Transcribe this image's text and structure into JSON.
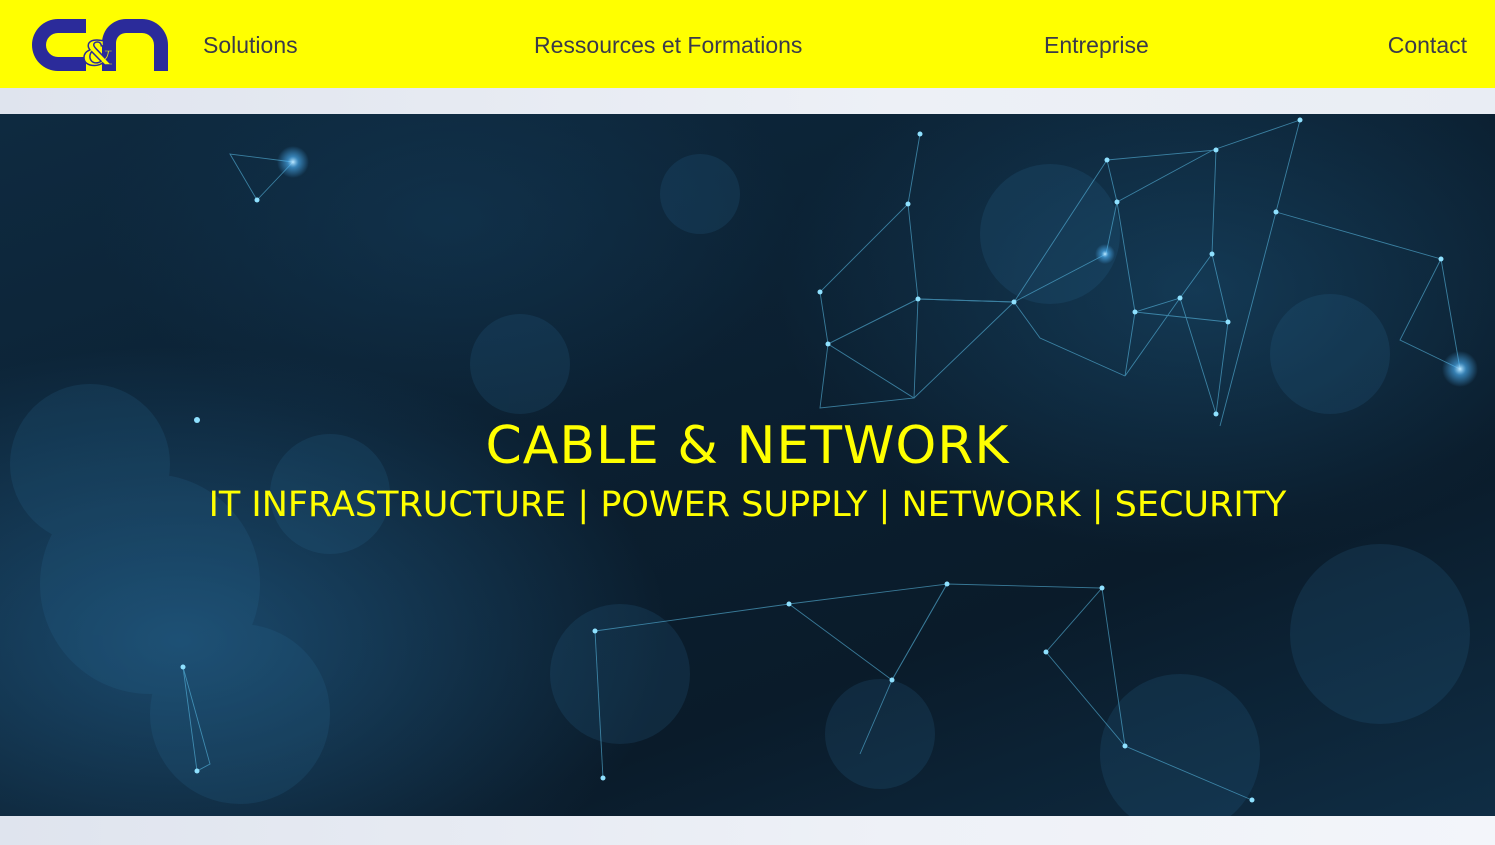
{
  "header": {
    "logo_alt": "C&N",
    "nav": {
      "solutions": "Solutions",
      "ressources": "Ressources et Formations",
      "entreprise": "Entreprise",
      "contact": "Contact"
    }
  },
  "hero": {
    "title": "CABLE & NETWORK",
    "subtitle": "IT INFRASTRUCTURE | POWER SUPPLY | NETWORK | SECURITY"
  },
  "colors": {
    "brand_yellow": "#ffff00",
    "logo_blue": "#2b2b9a",
    "nav_text": "#3a3a4a",
    "hero_bg": "#0b1f30"
  }
}
